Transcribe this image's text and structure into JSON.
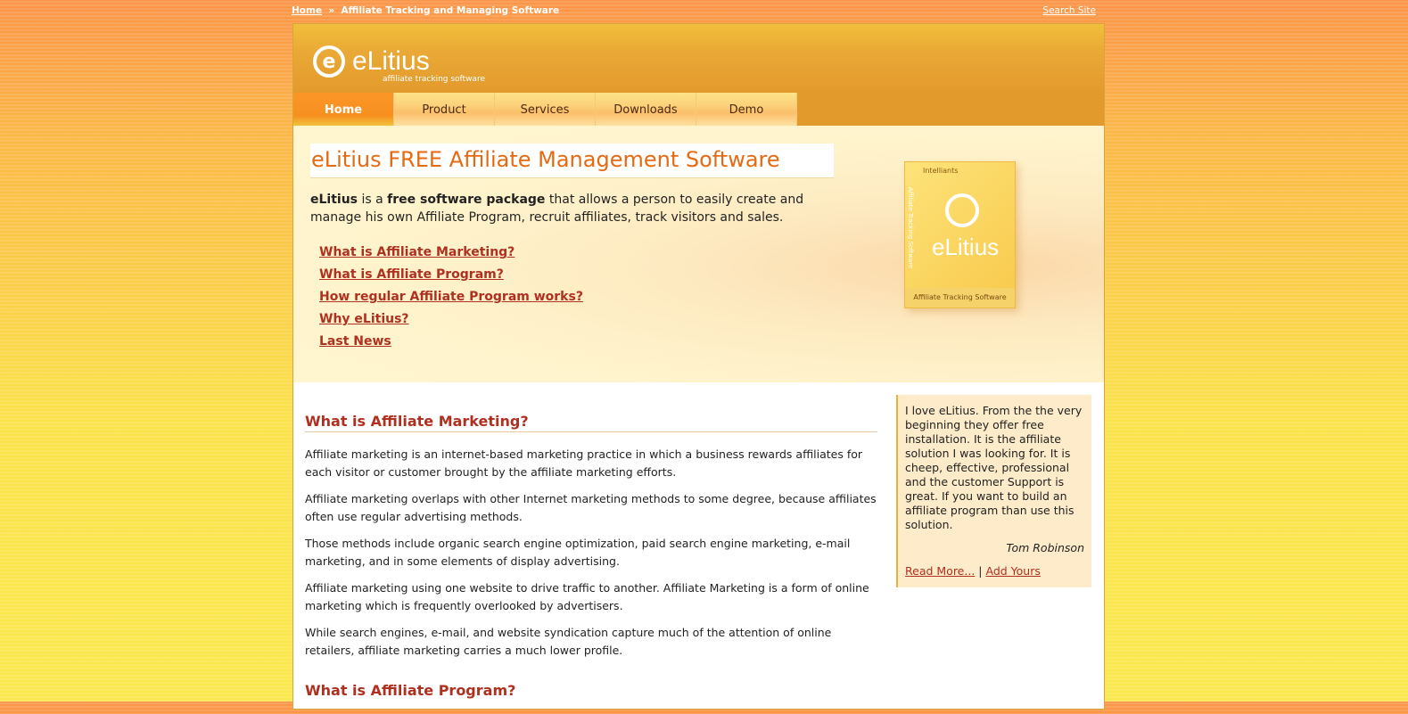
{
  "topbar": {
    "home": "Home",
    "sep": "»",
    "current": "Affiliate Tracking and Managing Software",
    "search": "Search Site"
  },
  "logo": {
    "mark": "e",
    "name": "eLitius",
    "tagline": "affiliate tracking software"
  },
  "nav": [
    "Home",
    "Product",
    "Services",
    "Downloads",
    "Demo"
  ],
  "hero": {
    "title": "eLitius FREE Affiliate Management Software",
    "intro_brand": "eLitius",
    "intro_mid": " is a ",
    "intro_bold": "free software package",
    "intro_rest": " that allows a person to easily create and manage his own Affiliate Program, recruit affiliates, track visitors and sales.",
    "links": [
      "What is Affiliate Marketing?",
      "What is Affiliate Program?",
      "How regular Affiliate Program works?",
      "Why eLitius?",
      "Last News"
    ],
    "box": {
      "brand": "Intelliants",
      "name": "eLitius",
      "side": "Affiliate Tracking Software",
      "foot": "Affiliate Tracking Software"
    }
  },
  "main": {
    "heading": "What is Affiliate Marketing?",
    "paragraphs": [
      "Affiliate marketing is an internet-based marketing practice in which a business rewards affiliates for each visitor or customer brought by the affiliate marketing efforts.",
      "Affiliate marketing overlaps with other Internet marketing methods to some degree, because affiliates often use regular advertising methods.",
      "Those methods include organic search engine optimization, paid search engine marketing, e-mail marketing, and in some elements of display advertising.",
      "Affiliate marketing using one website to drive traffic to another. Affiliate Marketing is a form of online marketing which is frequently overlooked by advertisers.",
      "While search engines, e-mail, and website syndication capture much of the attention of online retailers, affiliate marketing carries a much lower profile."
    ],
    "heading2": "What is Affiliate Program?"
  },
  "testimonial": {
    "text": "I love eLitius. From the the very beginning they offer free installation. It is the affiliate solution I was looking for. It is cheep, effective, professional and the customer Support is great. If you want to build an affiliate program than use this solution.",
    "author": "Tom Robinson",
    "read_more": "Read More...",
    "sep": "|",
    "add": "Add Yours"
  }
}
